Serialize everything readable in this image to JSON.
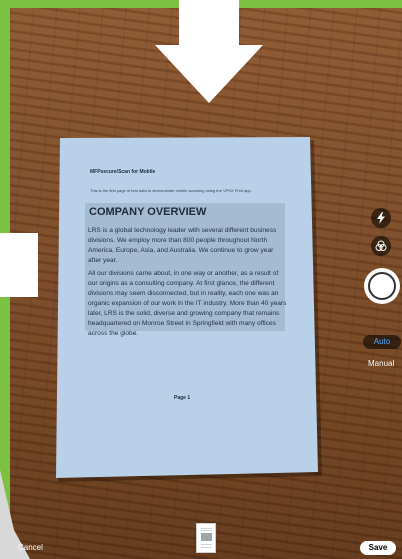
{
  "document": {
    "brand_line": "MFPsecure/Scan for Mobile",
    "intro_line": "This is the first page of test data to demonstrate mobile scanning using the VPSX Print app.",
    "heading": "COMPANY OVERVIEW",
    "paragraph1": "LRS is a global technology leader with several different business divisions. We employ more than 800 people throughout North America, Europe, Asia, and Australia. We continue to grow year after year.",
    "paragraph2": "All our divisions came about, in one way or another, as a result of our origins as a consulting company. At first glance, the different divisions may seem disconnected, but in reality, each one was an organic expansion of our work in the IT industry. More than 40 years later, LRS is the solid, diverse and growing company that remains headquartered on Monroe Street in Springfield with many offices across the globe.",
    "page_label": "Page 1"
  },
  "controls": {
    "flash_icon": "flash-icon",
    "filter_icon": "filter-icon",
    "shutter_icon": "shutter-button",
    "mode_auto": "Auto",
    "mode_manual": "Manual",
    "cancel": "Cancel",
    "save": "Save"
  },
  "colors": {
    "accent_green": "#7cc242",
    "auto_blue": "#4da3ff",
    "paper_tint": "#b8d0e8"
  }
}
